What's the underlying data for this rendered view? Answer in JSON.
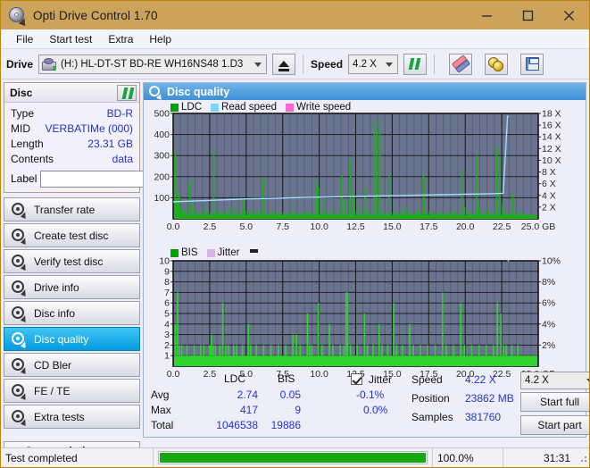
{
  "window": {
    "title": "Opti Drive Control 1.70",
    "icon": "disc-tool-icon",
    "minimize": "minimize-icon",
    "maximize": "maximize-icon",
    "close": "close-icon",
    "titlebar_color": "#cda35b"
  },
  "menu": {
    "items": [
      {
        "label": "File"
      },
      {
        "label": "Start test"
      },
      {
        "label": "Extra"
      },
      {
        "label": "Help"
      }
    ]
  },
  "toolbar": {
    "drive_label": "Drive",
    "drive_value": "(H:)  HL-DT-ST BD-RE  WH16NS48 1.D3",
    "eject_icon": "eject-icon",
    "speed_label": "Speed",
    "speed_value": "4.2 X",
    "refresh_icon": "refresh-icon",
    "erase_icon": "eraser-icon",
    "discs_icon": "gold-discs-icon",
    "save_icon": "save-floppy-icon"
  },
  "sidebar": {
    "disc_panel": {
      "title": "Disc",
      "refresh_icon": "refresh-icon",
      "rows": [
        {
          "key": "Type",
          "value": "BD-R"
        },
        {
          "key": "MID",
          "value": "VERBATIMe (000)"
        },
        {
          "key": "Length",
          "value": "23.31 GB"
        },
        {
          "key": "Contents",
          "value": "data"
        }
      ],
      "label_key": "Label",
      "label_value": "",
      "label_placeholder": "",
      "label_button_icon": "cd-disc-icon"
    },
    "nav": [
      {
        "label": "Transfer rate",
        "icon": "disc-test-icon",
        "active": false
      },
      {
        "label": "Create test disc",
        "icon": "disc-test-icon",
        "active": false
      },
      {
        "label": "Verify test disc",
        "icon": "disc-test-icon",
        "active": false
      },
      {
        "label": "Drive info",
        "icon": "disc-test-icon",
        "active": false
      },
      {
        "label": "Disc info",
        "icon": "disc-test-icon",
        "active": false
      },
      {
        "label": "Disc quality",
        "icon": "disc-test-icon",
        "active": true
      },
      {
        "label": "CD Bler",
        "icon": "disc-test-icon",
        "active": false
      },
      {
        "label": "FE / TE",
        "icon": "disc-test-icon",
        "active": false
      },
      {
        "label": "Extra tests",
        "icon": "disc-test-icon",
        "active": false
      }
    ],
    "status_window_button": "Status window > >"
  },
  "main": {
    "header_title": "Disc quality",
    "header_icon": "disc-quality-icon"
  },
  "stats": {
    "col_ldc": "LDC",
    "col_bis": "BIS",
    "rows": [
      {
        "key": "Avg",
        "ldc": "2.74",
        "bis": "0.05"
      },
      {
        "key": "Max",
        "ldc": "417",
        "bis": "9"
      },
      {
        "key": "Total",
        "ldc": "1046538",
        "bis": "19886"
      }
    ],
    "jitter_checkbox_label": "Jitter",
    "jitter_checked": true,
    "jitter_neg": "-0.1%",
    "jitter_pos": "0.0%",
    "speed_key": "Speed",
    "speed_value": "4.22 X",
    "position_key": "Position",
    "position_value": "23862 MB",
    "samples_key": "Samples",
    "samples_value": "381760",
    "speed_select": "4.2 X",
    "start_full_button": "Start full",
    "start_part_button": "Start part"
  },
  "statusbar": {
    "message": "Test completed",
    "progress_percent": "100.0%",
    "progress_value": 100,
    "elapsed": "31:31",
    "progress_color": "#16a80f"
  },
  "chart_data": [
    {
      "id": "ldc-chart",
      "type": "bar",
      "title": "",
      "xlabel": "GB",
      "ylabel": "LDC",
      "y2label": "Speed (X)",
      "xlim": [
        0,
        25
      ],
      "ylim": [
        0,
        500
      ],
      "y2lim": [
        0,
        18
      ],
      "grid": true,
      "legend_position": "top-left",
      "plot_bg": "#6b748f",
      "xticks": [
        "0.0",
        "2.5",
        "5.0",
        "7.5",
        "10.0",
        "12.5",
        "15.0",
        "17.5",
        "20.0",
        "22.5",
        "25.0 GB"
      ],
      "yticks": [
        100,
        200,
        300,
        400,
        500
      ],
      "y2ticks": [
        "2 X",
        "4 X",
        "6 X",
        "8 X",
        "10 X",
        "12 X",
        "14 X",
        "16 X",
        "18 X"
      ],
      "legend": [
        {
          "name": "LDC",
          "color": "#00a000"
        },
        {
          "name": "Read speed",
          "color": "#7fd4ff"
        },
        {
          "name": "Write speed",
          "color": "#ff66cc"
        }
      ],
      "series": [
        {
          "name": "LDC",
          "color": "#17b117",
          "kind": "impulse",
          "baseline": 18,
          "x": [
            0.15,
            0.28,
            0.42,
            0.55,
            0.62,
            0.78,
            0.95,
            1.15,
            1.35,
            1.55,
            1.78,
            1.95,
            2.15,
            2.35,
            2.55,
            2.78,
            2.95,
            3.15,
            3.35,
            3.55,
            3.75,
            3.95,
            4.15,
            4.35,
            4.55,
            4.78,
            4.95,
            5.15,
            5.35,
            5.55,
            5.78,
            5.95,
            6.15,
            6.35,
            6.55,
            6.78,
            6.95,
            7.15,
            7.35,
            7.55,
            7.78,
            7.95,
            8.15,
            8.35,
            8.55,
            8.78,
            8.95,
            9.15,
            9.35,
            9.55,
            9.78,
            9.95,
            10.15,
            10.35,
            10.55,
            10.78,
            10.95,
            11.15,
            11.35,
            11.55,
            11.78,
            11.95,
            12.15,
            12.35,
            12.55,
            12.78,
            12.95,
            13.15,
            13.35,
            13.55,
            13.78,
            13.95,
            14.15,
            14.35,
            14.55,
            14.78,
            14.95,
            15.15,
            15.35,
            15.55,
            15.78,
            15.95,
            16.15,
            16.35,
            16.55,
            16.78,
            16.95,
            17.15,
            17.35,
            17.55,
            17.78,
            17.95,
            18.15,
            18.35,
            18.55,
            18.78,
            18.95,
            19.15,
            19.35,
            19.55,
            19.78,
            19.95,
            20.15,
            20.35,
            20.55,
            20.78,
            20.95,
            21.15,
            21.35,
            21.55,
            21.78,
            21.95,
            22.15,
            22.35,
            22.55,
            22.72,
            22.85,
            23.05,
            23.25,
            23.45,
            23.65,
            23.85
          ],
          "y": [
            318,
            95,
            120,
            60,
            40,
            35,
            55,
            180,
            60,
            42,
            30,
            38,
            60,
            36,
            34,
            318,
            40,
            30,
            45,
            28,
            36,
            55,
            32,
            60,
            30,
            95,
            38,
            30,
            55,
            28,
            34,
            38,
            195,
            30,
            28,
            44,
            30,
            36,
            26,
            30,
            34,
            28,
            60,
            30,
            26,
            36,
            28,
            40,
            34,
            26,
            182,
            150,
            30,
            95,
            34,
            26,
            44,
            28,
            30,
            208,
            90,
            34,
            282,
            120,
            38,
            62,
            30,
            150,
            42,
            28,
            460,
            420,
            470,
            34,
            30,
            210,
            28,
            44,
            30,
            38,
            26,
            60,
            30,
            34,
            28,
            44,
            30,
            208,
            32,
            40,
            26,
            36,
            28,
            30,
            34,
            26,
            44,
            30,
            36,
            28,
            235,
            55,
            30,
            34,
            26,
            300,
            60,
            34,
            28,
            44,
            30,
            30,
            342,
            295,
            70,
            30,
            34,
            26,
            120,
            40,
            28,
            36
          ]
        },
        {
          "name": "Read speed",
          "color": "#9fe0ff",
          "kind": "line",
          "x": [
            0.0,
            1.0,
            2.0,
            3.0,
            4.0,
            5.0,
            6.0,
            7.0,
            8.0,
            9.0,
            10.0,
            11.0,
            12.0,
            13.0,
            14.0,
            15.0,
            16.0,
            17.0,
            18.0,
            19.0,
            20.0,
            21.0,
            22.0,
            22.6,
            22.9,
            23.0
          ],
          "y": [
            2.9,
            3.0,
            3.1,
            3.2,
            3.3,
            3.4,
            3.45,
            3.5,
            3.6,
            3.65,
            3.7,
            3.75,
            3.8,
            3.85,
            3.9,
            3.95,
            4.0,
            4.05,
            4.1,
            4.15,
            4.2,
            4.25,
            4.3,
            4.35,
            17.5,
            17.5
          ]
        }
      ]
    },
    {
      "id": "bis-chart",
      "type": "bar",
      "title": "",
      "xlabel": "GB",
      "ylabel": "BIS",
      "y2label": "Jitter (%)",
      "xlim": [
        0,
        25
      ],
      "ylim": [
        0,
        10
      ],
      "y2lim": [
        0,
        10
      ],
      "grid": true,
      "legend_position": "top-left",
      "plot_bg": "#6b748f",
      "xticks": [
        "0.0",
        "2.5",
        "5.0",
        "7.5",
        "10.0",
        "12.5",
        "15.0",
        "17.5",
        "20.0",
        "22.5",
        "25.0 GB"
      ],
      "yticks": [
        1,
        2,
        3,
        4,
        5,
        6,
        7,
        8,
        9,
        10
      ],
      "y2ticks": [
        "2%",
        "4%",
        "6%",
        "8%",
        "10%"
      ],
      "legend": [
        {
          "name": "BIS",
          "color": "#00a000"
        },
        {
          "name": "Jitter",
          "color": "#d9b3e6"
        }
      ],
      "series": [
        {
          "name": "BIS",
          "color": "#2fd42f",
          "kind": "impulse",
          "baseline": 1,
          "x": [
            0.15,
            0.3,
            0.45,
            0.6,
            0.78,
            0.95,
            1.2,
            1.45,
            1.7,
            1.9,
            2.1,
            2.3,
            2.5,
            2.62,
            2.75,
            2.9,
            3.05,
            3.2,
            3.4,
            3.6,
            3.78,
            3.95,
            4.15,
            4.35,
            4.55,
            4.75,
            4.95,
            5.15,
            5.3,
            5.5,
            5.7,
            5.95,
            6.2,
            6.45,
            6.7,
            6.95,
            7.2,
            7.45,
            7.7,
            7.95,
            8.2,
            8.45,
            8.7,
            8.95,
            9.2,
            9.35,
            9.5,
            9.7,
            9.95,
            10.2,
            10.45,
            10.7,
            10.95,
            11.2,
            11.45,
            11.7,
            11.85,
            11.95,
            12.15,
            12.35,
            12.6,
            12.85,
            13.1,
            13.3,
            13.5,
            13.7,
            13.9,
            14.1,
            14.3,
            14.5,
            14.7,
            14.9,
            15.1,
            15.3,
            15.5,
            15.7,
            15.95,
            16.2,
            16.45,
            16.7,
            16.95,
            17.2,
            17.45,
            17.7,
            17.95,
            18.2,
            18.45,
            18.7,
            18.95,
            19.2,
            19.45,
            19.7,
            19.95,
            20.2,
            20.45,
            20.7,
            20.95,
            21.2,
            21.45,
            21.7,
            21.95,
            22.2,
            22.45,
            22.6,
            22.8,
            23.0,
            23.2,
            23.4,
            23.6,
            23.8
          ],
          "y": [
            4,
            7,
            2,
            2,
            1,
            2,
            1,
            2,
            1,
            2,
            2,
            1,
            2,
            3,
            2,
            2,
            1,
            2,
            6,
            2,
            2,
            1,
            2,
            2,
            1,
            2,
            1,
            4,
            2,
            1,
            2,
            1,
            2,
            1,
            2,
            1,
            2,
            1,
            2,
            1,
            3,
            3,
            2,
            1,
            5,
            2,
            2,
            1,
            6,
            2,
            1,
            4,
            2,
            1,
            2,
            2,
            7,
            7,
            2,
            1,
            2,
            1,
            5,
            2,
            1,
            2,
            1,
            4,
            2,
            1,
            2,
            1,
            6,
            2,
            1,
            2,
            1,
            4,
            2,
            1,
            2,
            1,
            2,
            1,
            2,
            1,
            7,
            2,
            1,
            2,
            1,
            6,
            2,
            1,
            2,
            1,
            2,
            1,
            2,
            1,
            2,
            6,
            5,
            2,
            2,
            1,
            2,
            1,
            2,
            1
          ]
        },
        {
          "name": "Jitter",
          "color": "#9fe0ff",
          "kind": "line",
          "x": [
            22.9,
            23.0
          ],
          "y": [
            10,
            10
          ]
        }
      ]
    }
  ]
}
